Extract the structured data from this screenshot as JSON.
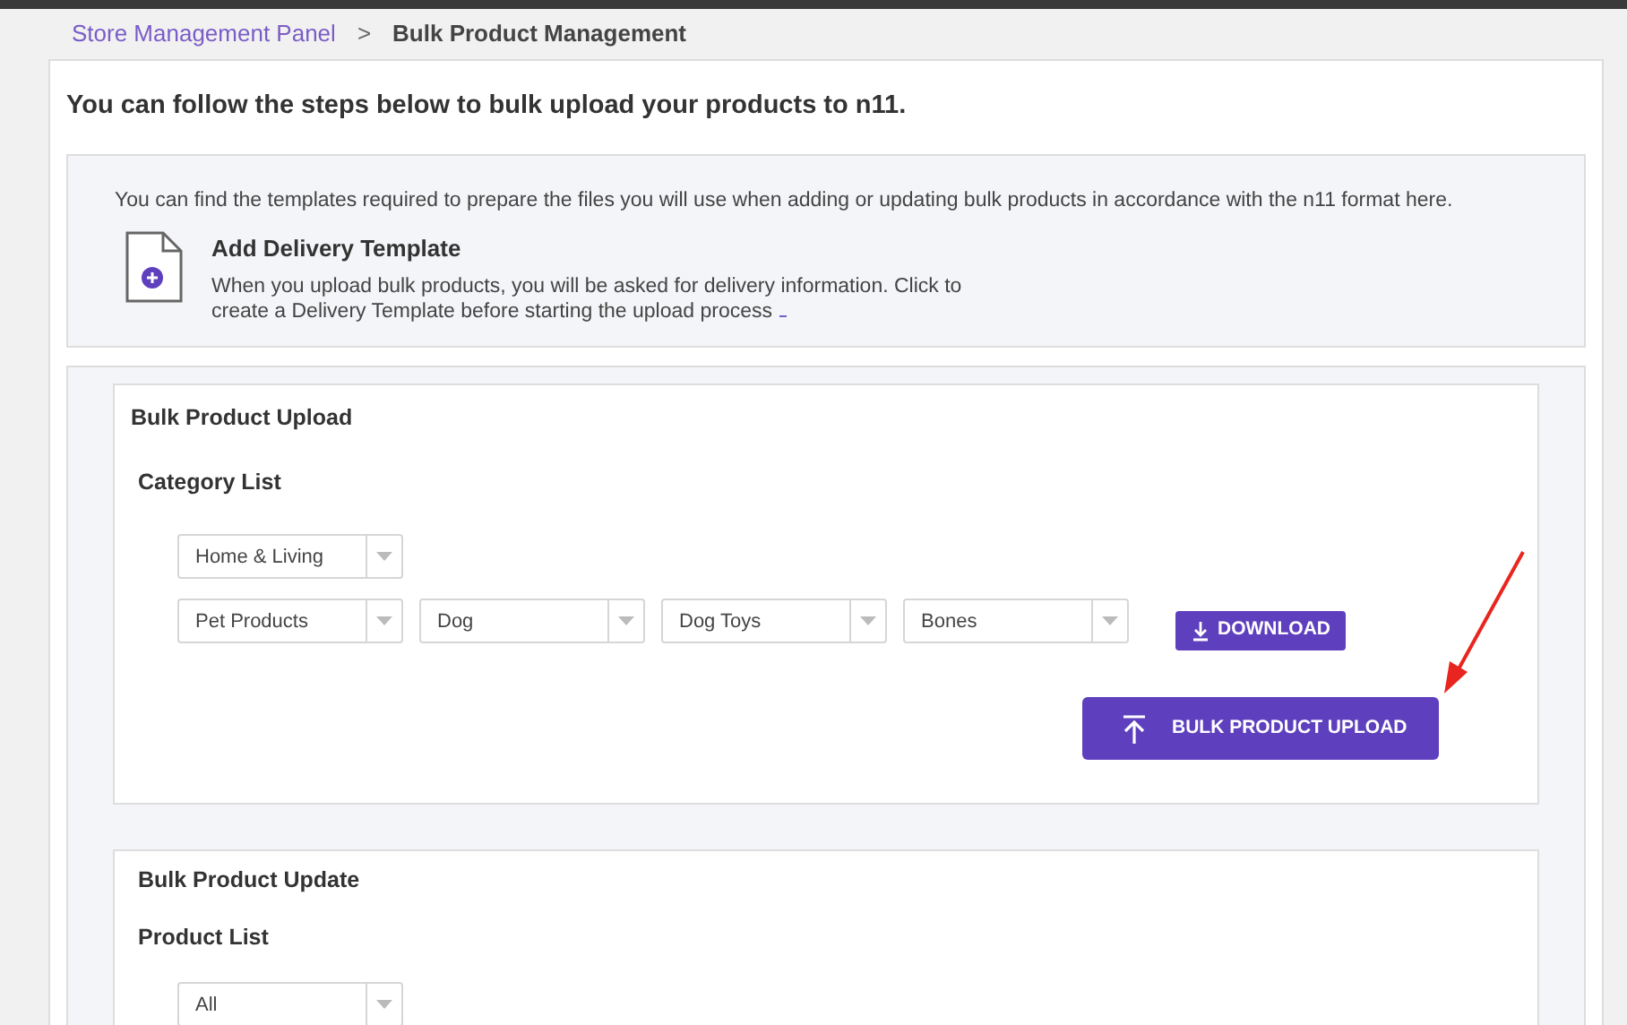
{
  "breadcrumb": [
    {
      "label": "Store Management Panel",
      "kind": "link"
    },
    {
      "label": "Bulk Product Management",
      "kind": "current"
    }
  ],
  "breadcrumb_separator": ">",
  "heading": "You can follow the steps below to bulk upload your products to n11.",
  "templates_info": {
    "text": "You can find the templates required to prepare the files you will use when adding or updating bulk products in accordance with the n11 format here.",
    "delivery_template": {
      "title": "Add Delivery Template",
      "description": "When you upload bulk products, you will be asked for delivery information. Click to create a Delivery Template before starting the upload process"
    }
  },
  "upload": {
    "title": "Bulk Product Upload",
    "category_label": "Category List",
    "category_rows": [
      [
        "Home & Living"
      ],
      [
        "Pet Products",
        "Dog",
        "Dog Toys",
        "Bones"
      ]
    ],
    "download_button": "DOWNLOAD",
    "upload_button": "BULK PRODUCT UPLOAD"
  },
  "update": {
    "title": "Bulk Product Update",
    "product_label": "Product List",
    "selects": [
      "All"
    ]
  }
}
